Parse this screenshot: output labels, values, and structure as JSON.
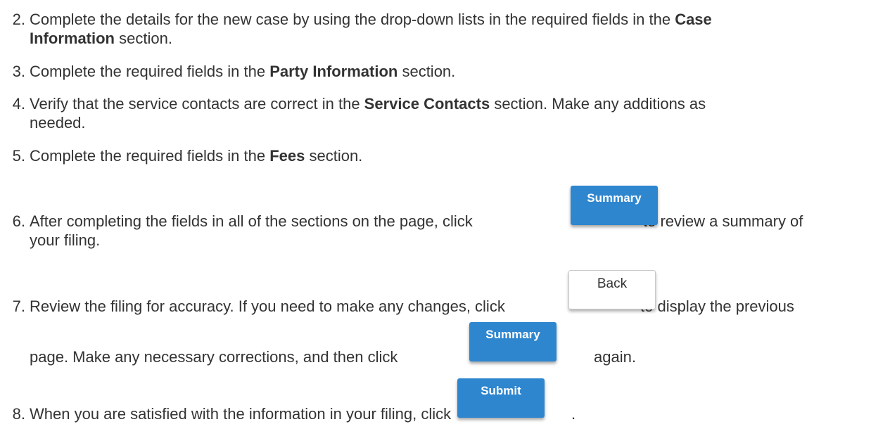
{
  "steps": [
    {
      "num": "2.",
      "line1_pre": "Complete the details for the new case by using the drop-down lists in the required fields in the ",
      "line1_bold": "Case",
      "line2_bold": "Information",
      "line2_post": " section."
    },
    {
      "num": "3.",
      "pre": "Complete the required fields in the ",
      "bold": "Party Information",
      "post": " section."
    },
    {
      "num": "4.",
      "line1_pre": "Verify that the service contacts are correct in the ",
      "line1_bold": "Service Contacts",
      "line1_post": " section. Make any additions as",
      "line2": "needed."
    },
    {
      "num": "5.",
      "pre": "Complete the required fields in the ",
      "bold": "Fees",
      "post": " section."
    },
    {
      "num": "6.",
      "line1_pre": "After completing the fields in all of the sections on the page, click",
      "line1_post": "to review a summary of",
      "line2": "your filing."
    },
    {
      "num": "7.",
      "line1_pre": "Review the filing for accuracy. If you need to make any changes, click",
      "line1_post": "to display the previous",
      "line2_pre": "page. Make any necessary corrections, and then click",
      "line2_post": "again."
    },
    {
      "num": "8.",
      "pre": "When you are satisfied with the information in your filing, click",
      "post": "."
    }
  ],
  "buttons": {
    "summary": "Summary",
    "back": "Back",
    "submit": "Submit"
  },
  "colors": {
    "primary_button": "#2e86cf",
    "text": "#333333"
  }
}
